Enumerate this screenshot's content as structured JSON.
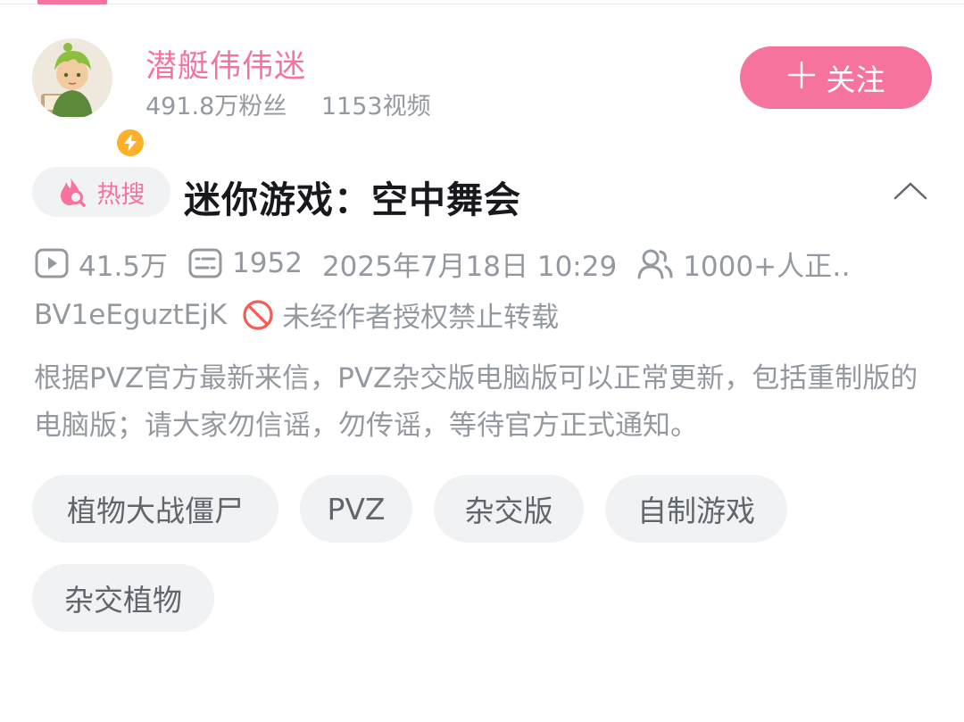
{
  "uploader": {
    "name": "潜艇伟伟迷",
    "followers": "491.8万粉丝",
    "videos": "1153视频",
    "follow_label": "关注"
  },
  "video": {
    "hot_label": "热搜",
    "title": "迷你游戏：空中舞会",
    "views": "41.5万",
    "danmaku": "1952",
    "datetime": "2025年7月18日 10:29",
    "watching": "1000+人正‥",
    "bvid": "BV1eEguztEjK",
    "copyright": "未经作者授权禁止转载",
    "description": "根据PVZ官方最新来信，PVZ杂交版电脑版可以正常更新，包括重制版的电脑版；请大家勿信谣，勿传谣，等待官方正式通知。"
  },
  "tags": [
    "植物大战僵尸",
    "PVZ",
    "杂交版",
    "自制游戏",
    "杂交植物"
  ],
  "colors": {
    "accent": "#f5739d",
    "muted": "#9499a0",
    "pill_bg": "#f1f2f3",
    "badge": "#ffb027"
  },
  "icons": [
    "play-count-icon",
    "danmaku-icon",
    "watching-people-icon",
    "no-repost-icon",
    "hot-search-flame-icon",
    "chevron-up-icon",
    "lightning-icon"
  ]
}
